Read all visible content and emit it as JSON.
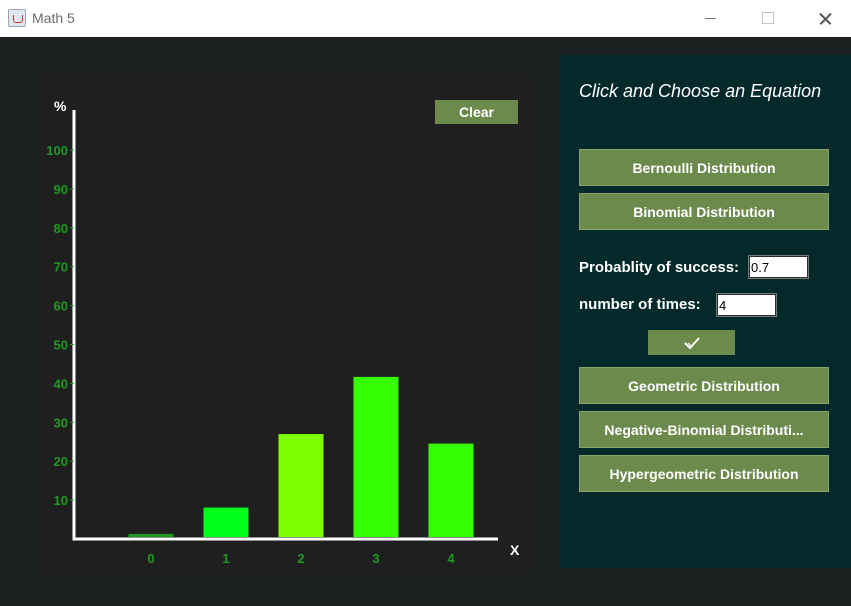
{
  "window": {
    "title": "Math 5"
  },
  "chart": {
    "clear_label": "Clear"
  },
  "chart_data": {
    "type": "bar",
    "categories": [
      "0",
      "1",
      "2",
      "3",
      "4"
    ],
    "values": [
      0.81,
      7.56,
      26.46,
      41.16,
      24.01
    ],
    "bar_colors": [
      "#1f9a1f",
      "#00ff1a",
      "#7dff00",
      "#33ff00",
      "#33ff00"
    ],
    "ylabel": "%",
    "xlabel": "X",
    "yticks": [
      10,
      20,
      30,
      40,
      50,
      60,
      70,
      80,
      90,
      100
    ],
    "ylim": [
      0,
      110
    ],
    "highlighted_category": "1"
  },
  "side": {
    "heading": "Click and Choose an Equation",
    "bernoulli": "Bernoulli Distribution",
    "binomial": "Binomial Distribution",
    "prob_label": "Probablity of success:",
    "prob_value": "0.7",
    "times_label": "number of times:",
    "times_value": "4",
    "confirm_icon": "checkmark-icon",
    "geometric": "Geometric Distribution",
    "negative_binomial": "Negative-Binomial Distributi...",
    "hypergeometric": "Hypergeometric Distribution"
  },
  "colors": {
    "button_green": "#6b8a4c",
    "panel_dark_teal": "#03292a",
    "chart_bg": "#1f1f20",
    "tick_green": "#1f9a1f"
  }
}
